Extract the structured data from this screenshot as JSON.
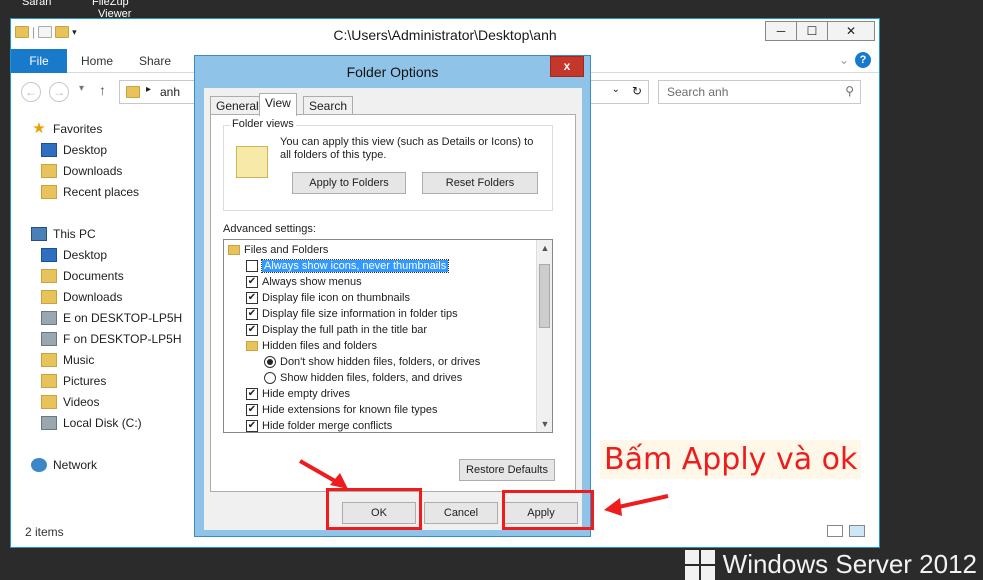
{
  "desktop": {
    "label1": "Sarah",
    "label2a": "FileZup",
    "label2b": "Viewer"
  },
  "explorer": {
    "title": "C:\\Users\\Administrator\\Desktop\\anh",
    "ribbon": {
      "file": "File",
      "home": "Home",
      "share": "Share"
    },
    "address": "anh",
    "search_placeholder": "Search anh",
    "status": "2 items",
    "nav": {
      "favorites": "Favorites",
      "desktop": "Desktop",
      "downloads": "Downloads",
      "recent": "Recent places",
      "thispc": "This PC",
      "pc_desktop": "Desktop",
      "documents": "Documents",
      "pc_downloads": "Downloads",
      "e_drive": "E on DESKTOP-LP5H",
      "f_drive": "F on DESKTOP-LP5H",
      "music": "Music",
      "pictures": "Pictures",
      "videos": "Videos",
      "local_disk": "Local Disk (C:)",
      "network": "Network"
    }
  },
  "dialog": {
    "title": "Folder Options",
    "close": "x",
    "tabs": {
      "general": "General",
      "view": "View",
      "search": "Search"
    },
    "folder_views": {
      "label": "Folder views",
      "text": "You can apply this view (such as Details or Icons) to all folders of this type.",
      "apply_btn": "Apply to Folders",
      "reset_btn": "Reset Folders"
    },
    "advanced_label": "Advanced settings:",
    "tree": {
      "root": "Files and Folders",
      "always_icons": "Always show icons, never thumbnails",
      "always_menus": "Always show menus",
      "file_icon_thumbs": "Display file icon on thumbnails",
      "file_size_tips": "Display file size information in folder tips",
      "full_path": "Display the full path in the title bar",
      "hidden_files": "Hidden files and folders",
      "dont_show_hidden": "Don't show hidden files, folders, or drives",
      "show_hidden": "Show hidden files, folders, and drives",
      "hide_empty": "Hide empty drives",
      "hide_ext": "Hide extensions for known file types",
      "hide_merge": "Hide folder merge conflicts"
    },
    "restore_btn": "Restore Defaults",
    "ok": "OK",
    "cancel": "Cancel",
    "apply": "Apply"
  },
  "annotation": "Bấm Apply và ok",
  "branding": "Windows Server 2012",
  "colors": {
    "accent": "#1979ca",
    "annotation_red": "#ee1c1c",
    "dialog_frame": "#8fc4e8"
  }
}
